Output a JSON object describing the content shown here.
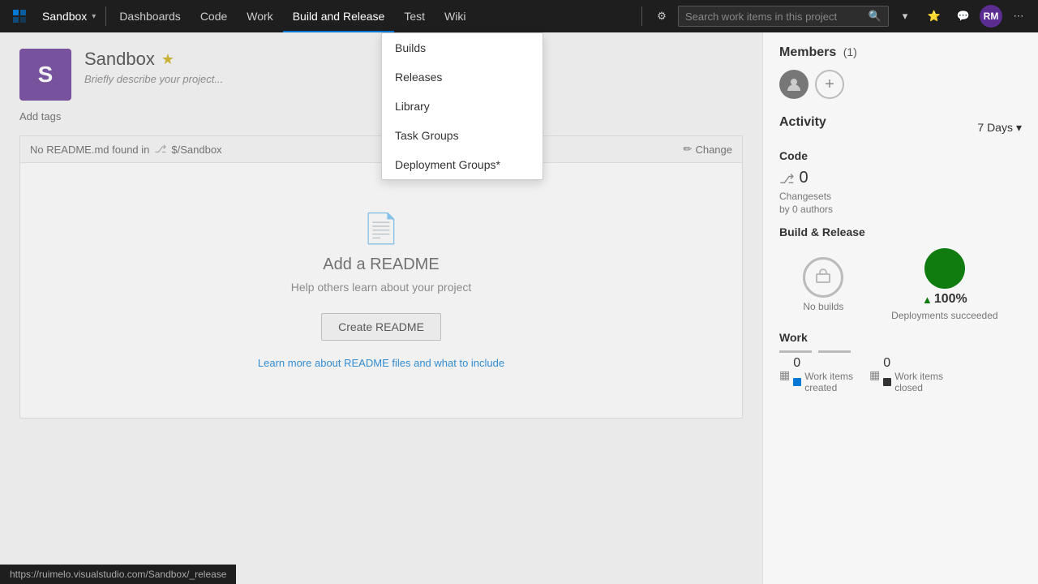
{
  "nav": {
    "logo_label": "Azure DevOps",
    "project_name": "Sandbox",
    "items": [
      {
        "label": "Dashboards",
        "active": false
      },
      {
        "label": "Code",
        "active": false
      },
      {
        "label": "Work",
        "active": false
      },
      {
        "label": "Build and Release",
        "active": true
      },
      {
        "label": "Test",
        "active": false
      },
      {
        "label": "Wiki",
        "active": false
      }
    ],
    "search_placeholder": "Search work items in this project",
    "avatar_initials": "RM"
  },
  "dropdown": {
    "items": [
      {
        "label": "Builds"
      },
      {
        "label": "Releases"
      },
      {
        "label": "Library"
      },
      {
        "label": "Task Groups"
      },
      {
        "label": "Deployment Groups*"
      }
    ]
  },
  "project": {
    "initial": "S",
    "name": "Sandbox",
    "description": "Briefly describe your project...",
    "add_tags_label": "Add tags"
  },
  "readme": {
    "no_readme_text": "No README.md found in",
    "path_icon": "$/Sandbox",
    "change_label": "Change",
    "icon": "📄",
    "title": "Add a README",
    "subtitle": "Help others learn about your project",
    "create_button": "Create README",
    "learn_link": "Learn more about README files and what to include"
  },
  "members": {
    "title": "Members",
    "count": "(1)"
  },
  "activity": {
    "title": "Activity",
    "days_label": "7 Days",
    "code_label": "Code",
    "changesets_count": "0",
    "changesets_label": "Changesets",
    "authors_label": "by 0 authors",
    "build_release_label": "Build & Release",
    "no_builds_label": "No builds",
    "deployments_pct": "100%",
    "deployments_label": "Deployments succeeded",
    "work_label": "Work",
    "work_items_created_count": "0",
    "work_items_closed_count": "0",
    "work_items_created_label": "Work items",
    "work_items_created_sub": "created",
    "work_items_closed_label": "Work items",
    "work_items_closed_sub": "closed"
  },
  "status_bar": {
    "url": "https://ruimelo.visualstudio.com/Sandbox/_release"
  }
}
